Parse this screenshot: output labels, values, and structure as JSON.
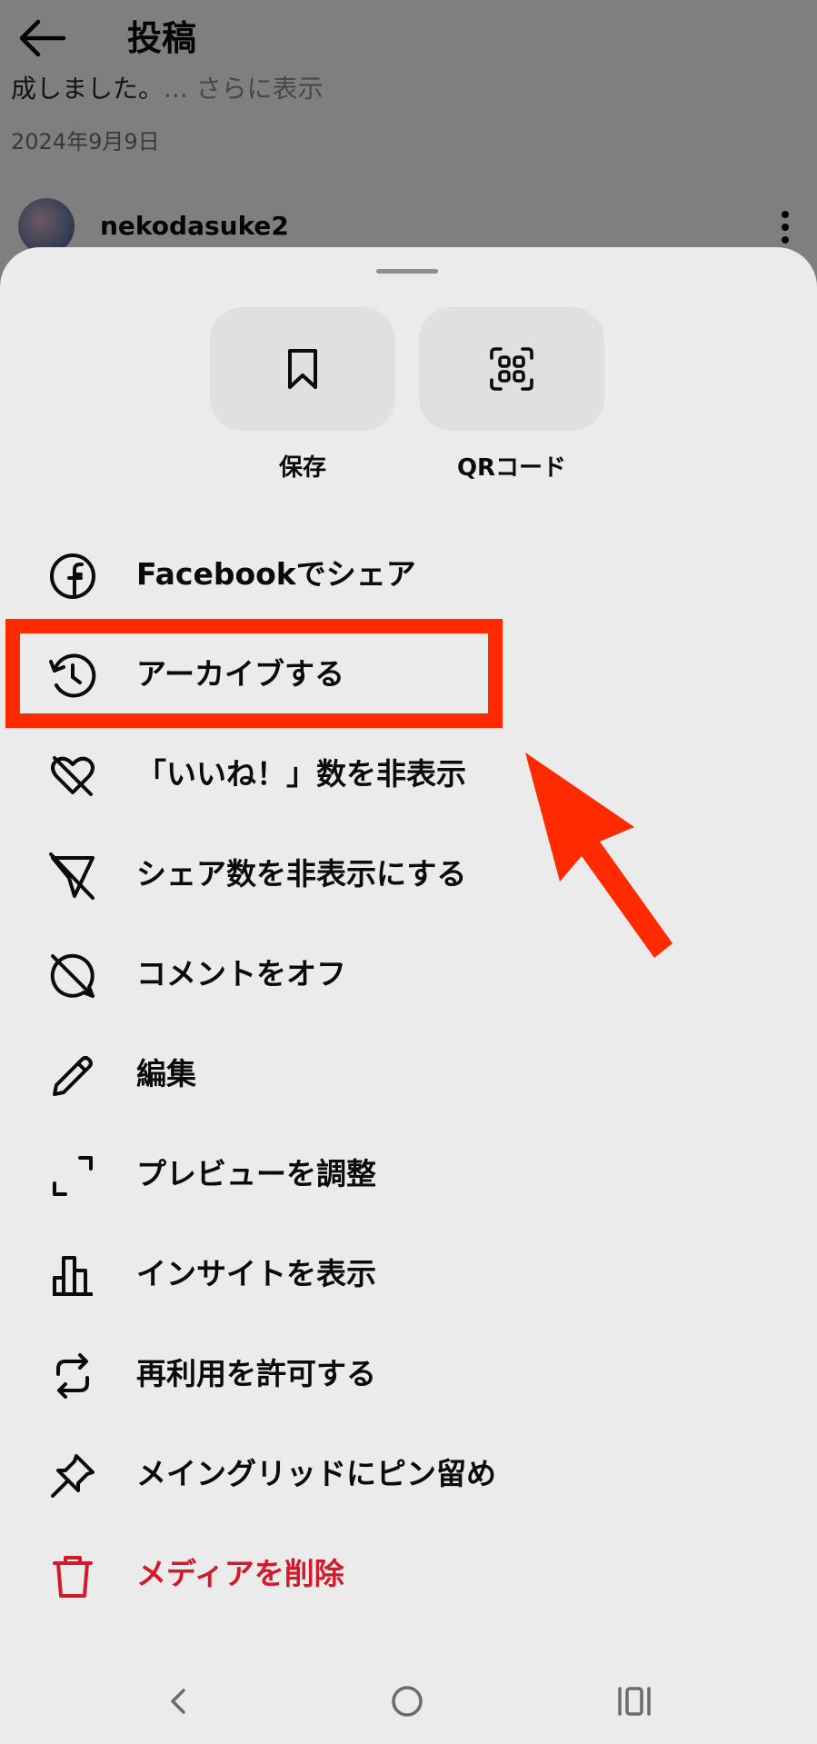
{
  "header": {
    "title": "投稿"
  },
  "post": {
    "caption_tail": "成しました。",
    "caption_more": "... さらに表示",
    "date": "2024年9月9日",
    "next_post_username": "nekodasuke2"
  },
  "sheet": {
    "quick_actions": [
      {
        "label": "保存",
        "icon": "bookmark-icon"
      },
      {
        "label": "QRコード",
        "icon": "qr-code-icon"
      }
    ],
    "items": [
      {
        "label": "Facebookでシェア",
        "icon": "facebook-icon"
      },
      {
        "label": "アーカイブする",
        "icon": "archive-clock-icon"
      },
      {
        "label": "「いいね！」数を非表示",
        "icon": "heart-off-icon"
      },
      {
        "label": "シェア数を非表示にする",
        "icon": "share-off-icon"
      },
      {
        "label": "コメントをオフ",
        "icon": "comment-off-icon"
      },
      {
        "label": "編集",
        "icon": "pencil-icon"
      },
      {
        "label": "プレビューを調整",
        "icon": "crop-icon"
      },
      {
        "label": "インサイトを表示",
        "icon": "bar-chart-icon"
      },
      {
        "label": "再利用を許可する",
        "icon": "remix-icon"
      },
      {
        "label": "メイングリッドにピン留め",
        "icon": "pin-icon"
      },
      {
        "label": "メディアを削除",
        "icon": "trash-icon"
      }
    ]
  },
  "colors": {
    "accent_red": "#ff2a00",
    "danger_text": "#d21a2c",
    "sheet_bg": "#ebebeb"
  }
}
